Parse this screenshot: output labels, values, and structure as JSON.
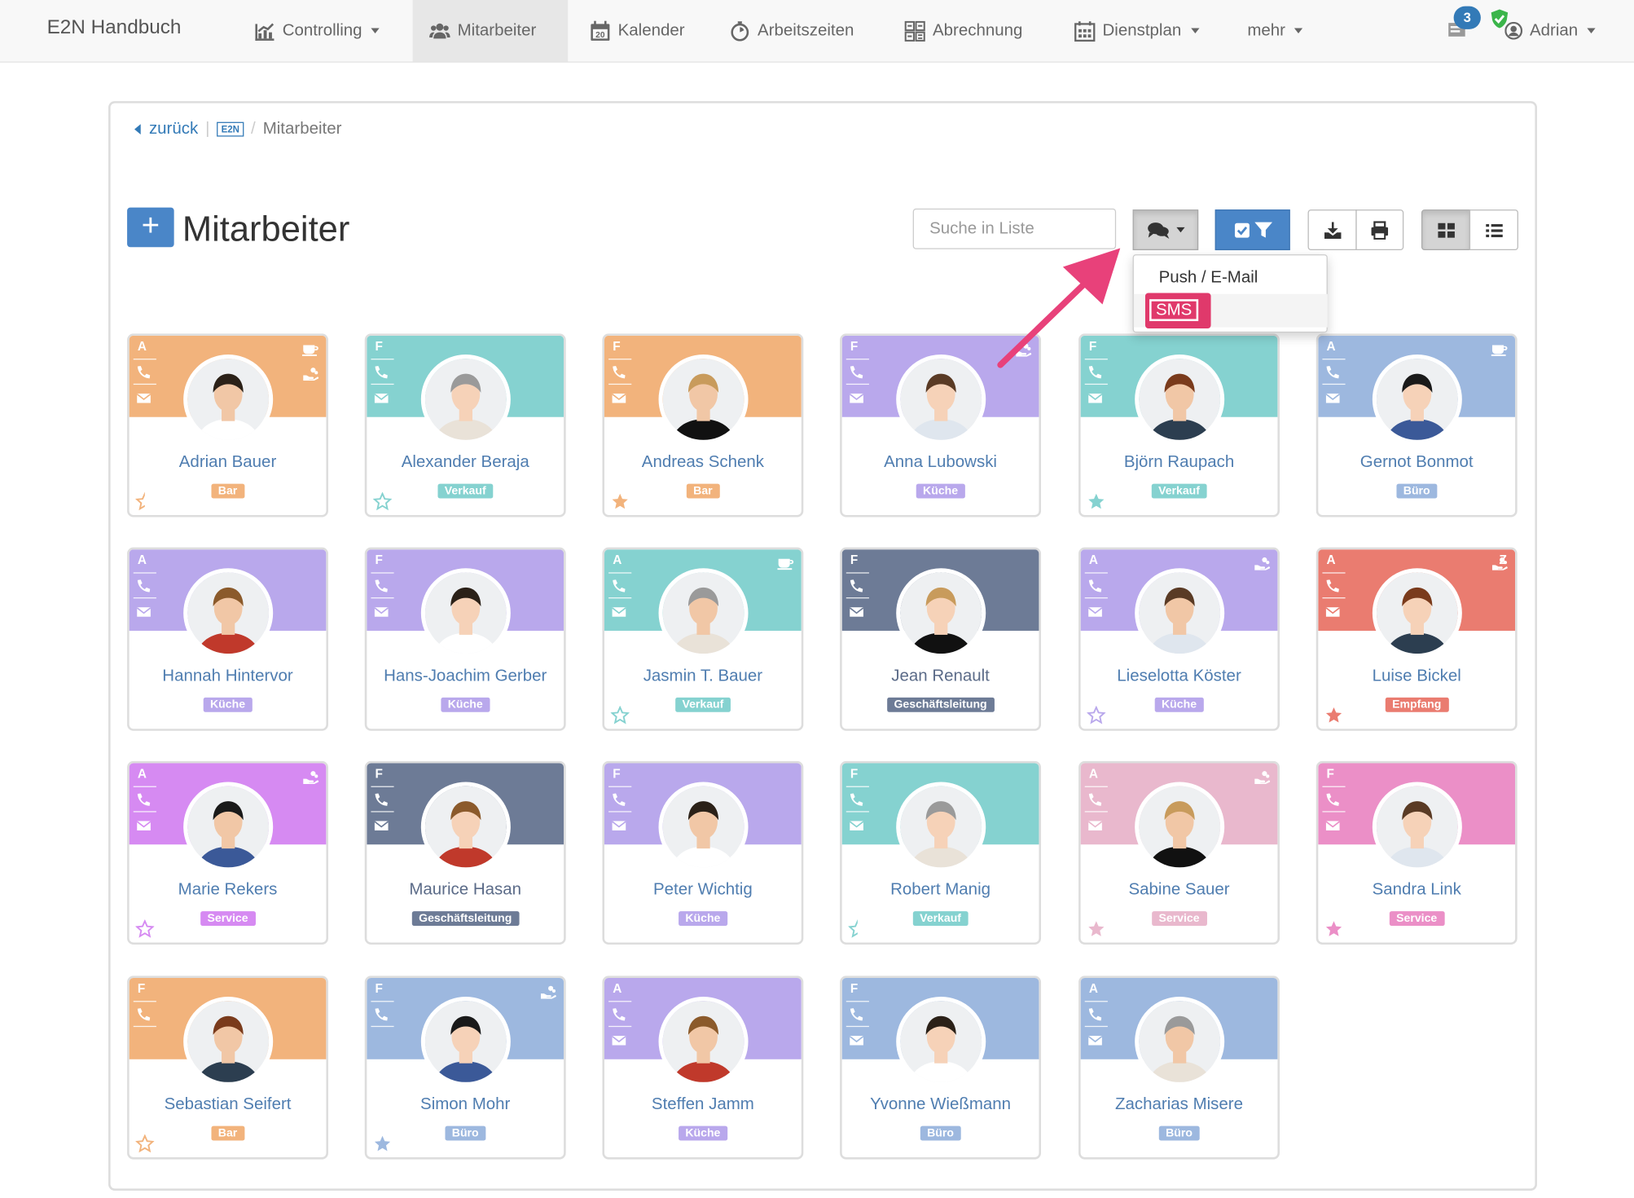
{
  "nav": {
    "brand": "E2N Handbuch",
    "items": [
      "Controlling",
      "Mitarbeiter",
      "Kalender",
      "Arbeitszeiten",
      "Abrechnung",
      "Dienstplan",
      "mehr"
    ],
    "calendar_day": "20",
    "badge_count": "3",
    "user": "Adrian"
  },
  "breadcrumb": {
    "back": "zurück",
    "logo": "E2N",
    "current": "Mitarbeiter"
  },
  "page": {
    "title": "Mitarbeiter",
    "add": "+"
  },
  "search": {
    "placeholder": "Suche in Liste"
  },
  "dropdown": {
    "items": [
      "Push / E-Mail",
      "SMS"
    ]
  },
  "colors": {
    "accent": "#337ab7",
    "primary_btn": "#4a86c8",
    "highlight": "#e0396b",
    "orange": "#f2b37c",
    "teal": "#85d2d0",
    "lavender": "#b9a8ec",
    "blue": "#9db8df",
    "slate": "#6d7b96",
    "red": "#ea7c70",
    "magenta": "#d68af2",
    "pink": "#e9b8cd",
    "hotpink": "#eb8fc7"
  },
  "employees": [
    {
      "name": "Adrian Bauer",
      "tag": "Bar",
      "status": "A",
      "color": "orange",
      "star": "half",
      "right": [
        "cup",
        "hand"
      ]
    },
    {
      "name": "Alexander Beraja",
      "tag": "Verkauf",
      "status": "F",
      "color": "teal",
      "star": "empty",
      "right": []
    },
    {
      "name": "Andreas Schenk",
      "tag": "Bar",
      "status": "F",
      "color": "orange",
      "star": "full",
      "right": []
    },
    {
      "name": "Anna Lubowski",
      "tag": "Küche",
      "status": "F",
      "color": "lavender",
      "star": "none",
      "right": [
        "hand"
      ]
    },
    {
      "name": "Björn Raupach",
      "tag": "Verkauf",
      "status": "F",
      "color": "teal",
      "star": "full",
      "right": []
    },
    {
      "name": "Gernot Bonmot",
      "tag": "Büro",
      "status": "A",
      "color": "blue",
      "star": "none",
      "right": [
        "cup"
      ]
    },
    {
      "name": "Hannah Hintervor",
      "tag": "Küche",
      "status": "A",
      "color": "lavender",
      "star": "none",
      "right": []
    },
    {
      "name": "Hans-Joachim Gerber",
      "tag": "Küche",
      "status": "F",
      "color": "lavender",
      "star": "none",
      "right": []
    },
    {
      "name": "Jasmin T. Bauer",
      "tag": "Verkauf",
      "status": "A",
      "color": "teal",
      "star": "empty",
      "right": [
        "cup"
      ]
    },
    {
      "name": "Jean Renault",
      "tag": "Geschäftsleitung",
      "status": "F",
      "color": "slate",
      "star": "none",
      "right": []
    },
    {
      "name": "Lieselotta Köster",
      "tag": "Küche",
      "status": "A",
      "color": "lavender",
      "star": "empty",
      "right": [
        "hand"
      ]
    },
    {
      "name": "Luise Bickel",
      "tag": "Empfang",
      "status": "A",
      "color": "red",
      "star": "full",
      "right": [
        "hand"
      ],
      "extra": "Z"
    },
    {
      "name": "Marie Rekers",
      "tag": "Service",
      "status": "A",
      "color": "magenta",
      "star": "empty",
      "right": [
        "hand"
      ]
    },
    {
      "name": "Maurice Hasan",
      "tag": "Geschäftsleitung",
      "status": "F",
      "color": "slate",
      "star": "none",
      "right": []
    },
    {
      "name": "Peter Wichtig",
      "tag": "Küche",
      "status": "F",
      "color": "lavender",
      "star": "none",
      "right": []
    },
    {
      "name": "Robert Manig",
      "tag": "Verkauf",
      "status": "F",
      "color": "teal",
      "star": "half",
      "right": []
    },
    {
      "name": "Sabine Sauer",
      "tag": "Service",
      "status": "A",
      "color": "pink",
      "star": "full",
      "right": [
        "hand"
      ]
    },
    {
      "name": "Sandra Link",
      "tag": "Service",
      "status": "F",
      "color": "hotpink",
      "star": "full",
      "right": []
    },
    {
      "name": "Sebastian Seifert",
      "tag": "Bar",
      "status": "F",
      "color": "orange",
      "star": "empty",
      "right": [],
      "nomail": true
    },
    {
      "name": "Simon Mohr",
      "tag": "Büro",
      "status": "F",
      "color": "blue",
      "star": "full",
      "right": [
        "hand"
      ],
      "nomail": true
    },
    {
      "name": "Steffen Jamm",
      "tag": "Küche",
      "status": "A",
      "color": "lavender",
      "star": "none",
      "right": []
    },
    {
      "name": "Yvonne Wießmann",
      "tag": "Büro",
      "status": "F",
      "color": "blue",
      "star": "none",
      "right": []
    },
    {
      "name": "Zacharias Misere",
      "tag": "Büro",
      "status": "A",
      "color": "blue",
      "star": "none",
      "right": []
    }
  ]
}
